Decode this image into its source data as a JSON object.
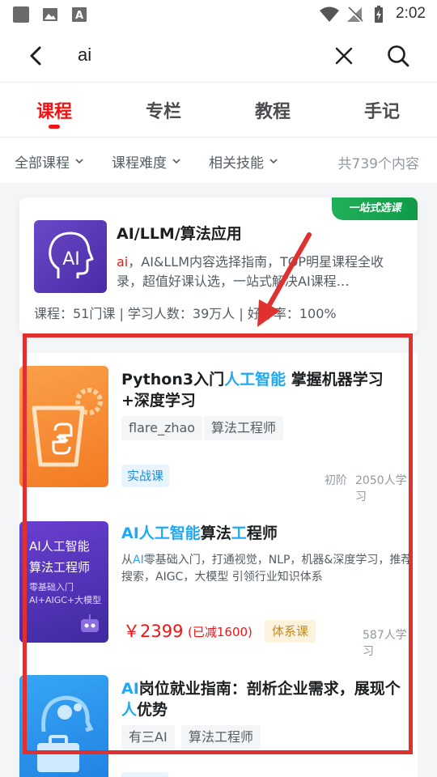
{
  "status_bar": {
    "time": "2:02"
  },
  "search": {
    "query": "ai"
  },
  "tabs": [
    {
      "label": "课程",
      "active": true
    },
    {
      "label": "专栏",
      "active": false
    },
    {
      "label": "教程",
      "active": false
    },
    {
      "label": "手记",
      "active": false
    }
  ],
  "filters": {
    "items": [
      "全部课程",
      "课程难度",
      "相关技能"
    ],
    "count": "共739个内容"
  },
  "featured": {
    "badge": "一站式选课",
    "title": "AI/LLM/算法应用",
    "desc_highlight": "ai",
    "desc": "，AI&LLM内容选择指南，TOP明星课程全收录，超值好课认选，一站式解决AI课程…",
    "stats": "课程：51门课 | 学习人数：39万人 | 好评率：100%"
  },
  "courses": [
    {
      "title_parts": [
        {
          "text": "Python3入门",
          "hl": false
        },
        {
          "text": "人工智能",
          "hl": true
        },
        {
          "text": " 掌握机器学习+深度学习",
          "hl": false
        }
      ],
      "tags": [
        "flare_zhao",
        "算法工程师"
      ],
      "type": "实战课",
      "level": "初阶",
      "learners": "2050人学习"
    },
    {
      "title_parts": [
        {
          "text": "AI人工智能",
          "hl": true
        },
        {
          "text": "算法",
          "hl": false
        },
        {
          "text": "工",
          "hl": true
        },
        {
          "text": "程师",
          "hl": false
        }
      ],
      "thumb_lines": [
        "AI人工智能",
        "算法工程师",
        "零基础入门",
        "AI+AIGC+大模型"
      ],
      "desc_parts": [
        {
          "text": "从",
          "hl": false
        },
        {
          "text": "AI",
          "hl": true
        },
        {
          "text": "零基础入门，打通视觉，NLP，机器&深度学习，推荐搜索，AIGC，大模型 引领行业知识体系",
          "hl": false
        }
      ],
      "price": "￥2399",
      "discount": "(已减1600)",
      "type": "体系课",
      "learners": "587人学习"
    },
    {
      "title_parts": [
        {
          "text": "AI",
          "hl": true
        },
        {
          "text": "岗位就业指南：剖析企业需求，展现个",
          "hl": false
        },
        {
          "text": "人",
          "hl": true
        },
        {
          "text": "优势",
          "hl": false
        }
      ],
      "tags": [
        "有三AI",
        "算法工程师"
      ]
    }
  ],
  "colors": {
    "accent": "#f01414",
    "highlight": "#1fa8f3",
    "annotation": "#e03030"
  }
}
